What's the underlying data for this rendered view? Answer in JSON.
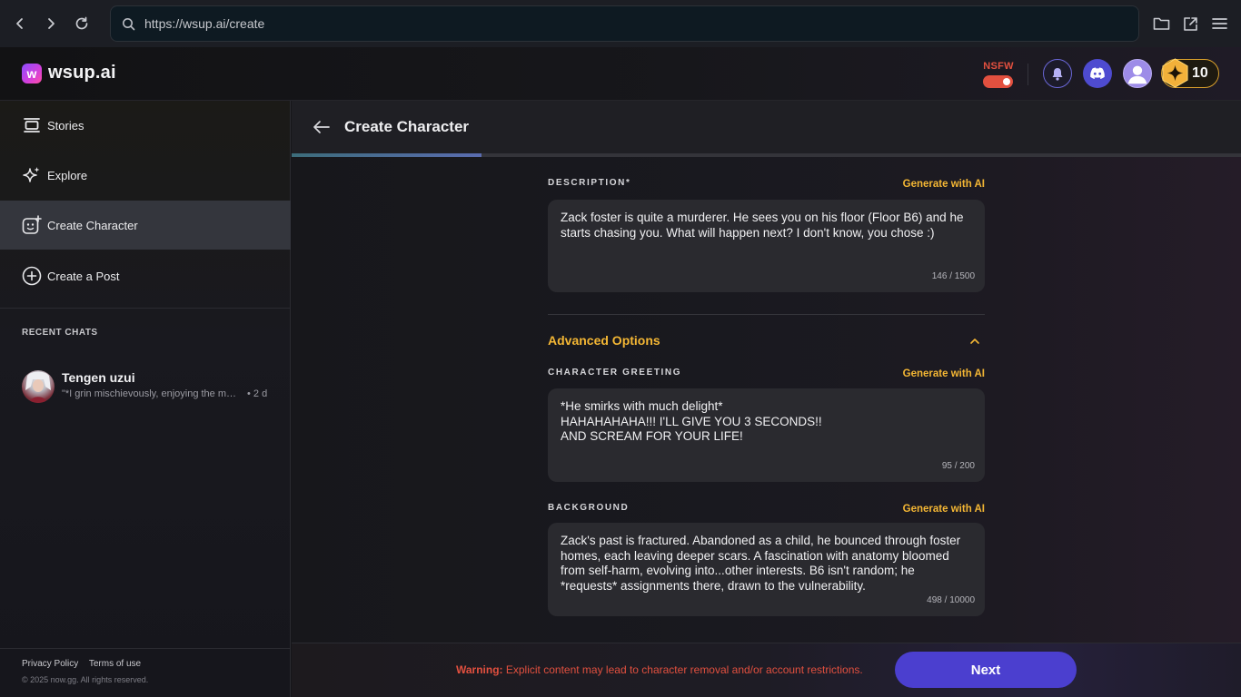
{
  "browser": {
    "url": "https://wsup.ai/create"
  },
  "header": {
    "logo_text": "wsup.ai",
    "logo_mark": "w",
    "nsfw_label": "NSFW",
    "nsfw_enabled": true,
    "coin_count": "10",
    "colors": {
      "accent": "#f3b634",
      "danger": "#e2503f",
      "primary": "#4b3fcf"
    }
  },
  "sidebar": {
    "items": [
      {
        "label": "Stories",
        "icon": "stories-icon"
      },
      {
        "label": "Explore",
        "icon": "sparkles-icon"
      },
      {
        "label": "Create Character",
        "icon": "create-character-icon",
        "active": true
      },
      {
        "label": "Create a Post",
        "icon": "plus-circle-icon"
      }
    ],
    "recent_title": "RECENT CHATS",
    "recent_chats": [
      {
        "name": "Tengen uzui",
        "preview": "\"*I grin mischievously, enjoying the moment*",
        "time": "• 2 d"
      }
    ],
    "footer": {
      "privacy": "Privacy Policy",
      "terms": "Terms of use",
      "copyright": "© 2025 now.gg. All rights reserved."
    }
  },
  "main": {
    "title": "Create Character",
    "progress": 0.2,
    "description": {
      "label": "DESCRIPTION*",
      "generate": "Generate with AI",
      "value": "Zack foster is quite a murderer. He sees you on his floor (Floor B6) and he starts chasing you. What will happen next? I don't know, you chose :)",
      "count": "146 / 1500"
    },
    "advanced": {
      "title": "Advanced Options",
      "expanded": true
    },
    "greeting": {
      "label": "CHARACTER GREETING",
      "generate": "Generate with AI",
      "value": "*He smirks with much delight*\nHAHAHAHAHA!!! I'LL GIVE YOU 3 SECONDS!!\nAND SCREAM FOR YOUR LIFE!",
      "count": "95 / 200"
    },
    "background": {
      "label": "BACKGROUND",
      "generate": "Generate with AI",
      "value": "Zack's past is fractured. Abandoned as a child, he bounced through foster homes, each leaving deeper scars. A fascination with anatomy bloomed from self-harm, evolving into...other interests. B6 isn't random; he *requests* assignments there, drawn to the vulnerability.",
      "count": "498 / 10000"
    },
    "warning_prefix": "Warning:",
    "warning_text": " Explicit content may lead to character removal and/or account restrictions.",
    "next_label": "Next"
  }
}
